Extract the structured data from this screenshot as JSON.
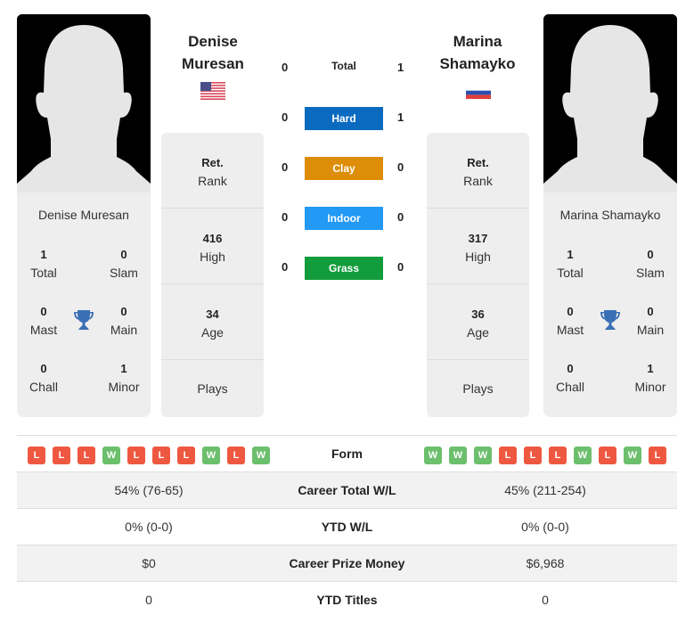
{
  "colors": {
    "hard": "#0a6abf",
    "clay": "#dd8d07",
    "indoor": "#2299f5",
    "grass": "#129c3c",
    "win": "#6cbf6c",
    "loss": "#ee5840",
    "trophy": "#3a6fb5"
  },
  "player_left": {
    "name_line1": "Denise",
    "name_line2": "Muresan",
    "full_name": "Denise Muresan",
    "flag": "usa-flag",
    "rank": {
      "value": "Ret.",
      "label": "Rank"
    },
    "high": {
      "value": "416",
      "label": "High"
    },
    "age": {
      "value": "34",
      "label": "Age"
    },
    "plays": {
      "value": "",
      "label": "Plays"
    },
    "titles": {
      "total": {
        "value": "1",
        "label": "Total"
      },
      "slam": {
        "value": "0",
        "label": "Slam"
      },
      "mast": {
        "value": "0",
        "label": "Mast"
      },
      "main": {
        "value": "0",
        "label": "Main"
      },
      "chall": {
        "value": "0",
        "label": "Chall"
      },
      "minor": {
        "value": "1",
        "label": "Minor"
      }
    },
    "form": [
      "L",
      "L",
      "L",
      "W",
      "L",
      "L",
      "L",
      "W",
      "L",
      "W"
    ]
  },
  "player_right": {
    "name_line1": "Marina",
    "name_line2": "Shamayko",
    "full_name": "Marina Shamayko",
    "flag": "russia-flag",
    "rank": {
      "value": "Ret.",
      "label": "Rank"
    },
    "high": {
      "value": "317",
      "label": "High"
    },
    "age": {
      "value": "36",
      "label": "Age"
    },
    "plays": {
      "value": "",
      "label": "Plays"
    },
    "titles": {
      "total": {
        "value": "1",
        "label": "Total"
      },
      "slam": {
        "value": "0",
        "label": "Slam"
      },
      "mast": {
        "value": "0",
        "label": "Mast"
      },
      "main": {
        "value": "0",
        "label": "Main"
      },
      "chall": {
        "value": "0",
        "label": "Chall"
      },
      "minor": {
        "value": "1",
        "label": "Minor"
      }
    },
    "form": [
      "W",
      "W",
      "W",
      "L",
      "L",
      "L",
      "W",
      "L",
      "W",
      "L"
    ]
  },
  "h2h": [
    {
      "label": "Total",
      "left": "0",
      "right": "1",
      "surface": "total"
    },
    {
      "label": "Hard",
      "left": "0",
      "right": "1",
      "surface": "hard"
    },
    {
      "label": "Clay",
      "left": "0",
      "right": "0",
      "surface": "clay"
    },
    {
      "label": "Indoor",
      "left": "0",
      "right": "0",
      "surface": "indoor"
    },
    {
      "label": "Grass",
      "left": "0",
      "right": "0",
      "surface": "grass"
    }
  ],
  "comparison": {
    "form_label": "Form",
    "rows": [
      {
        "label": "Career Total W/L",
        "left": "54% (76-65)",
        "right": "45% (211-254)"
      },
      {
        "label": "YTD W/L",
        "left": "0% (0-0)",
        "right": "0% (0-0)"
      },
      {
        "label": "Career Prize Money",
        "left": "$0",
        "right": "$6,968"
      },
      {
        "label": "YTD Titles",
        "left": "0",
        "right": "0"
      }
    ]
  }
}
